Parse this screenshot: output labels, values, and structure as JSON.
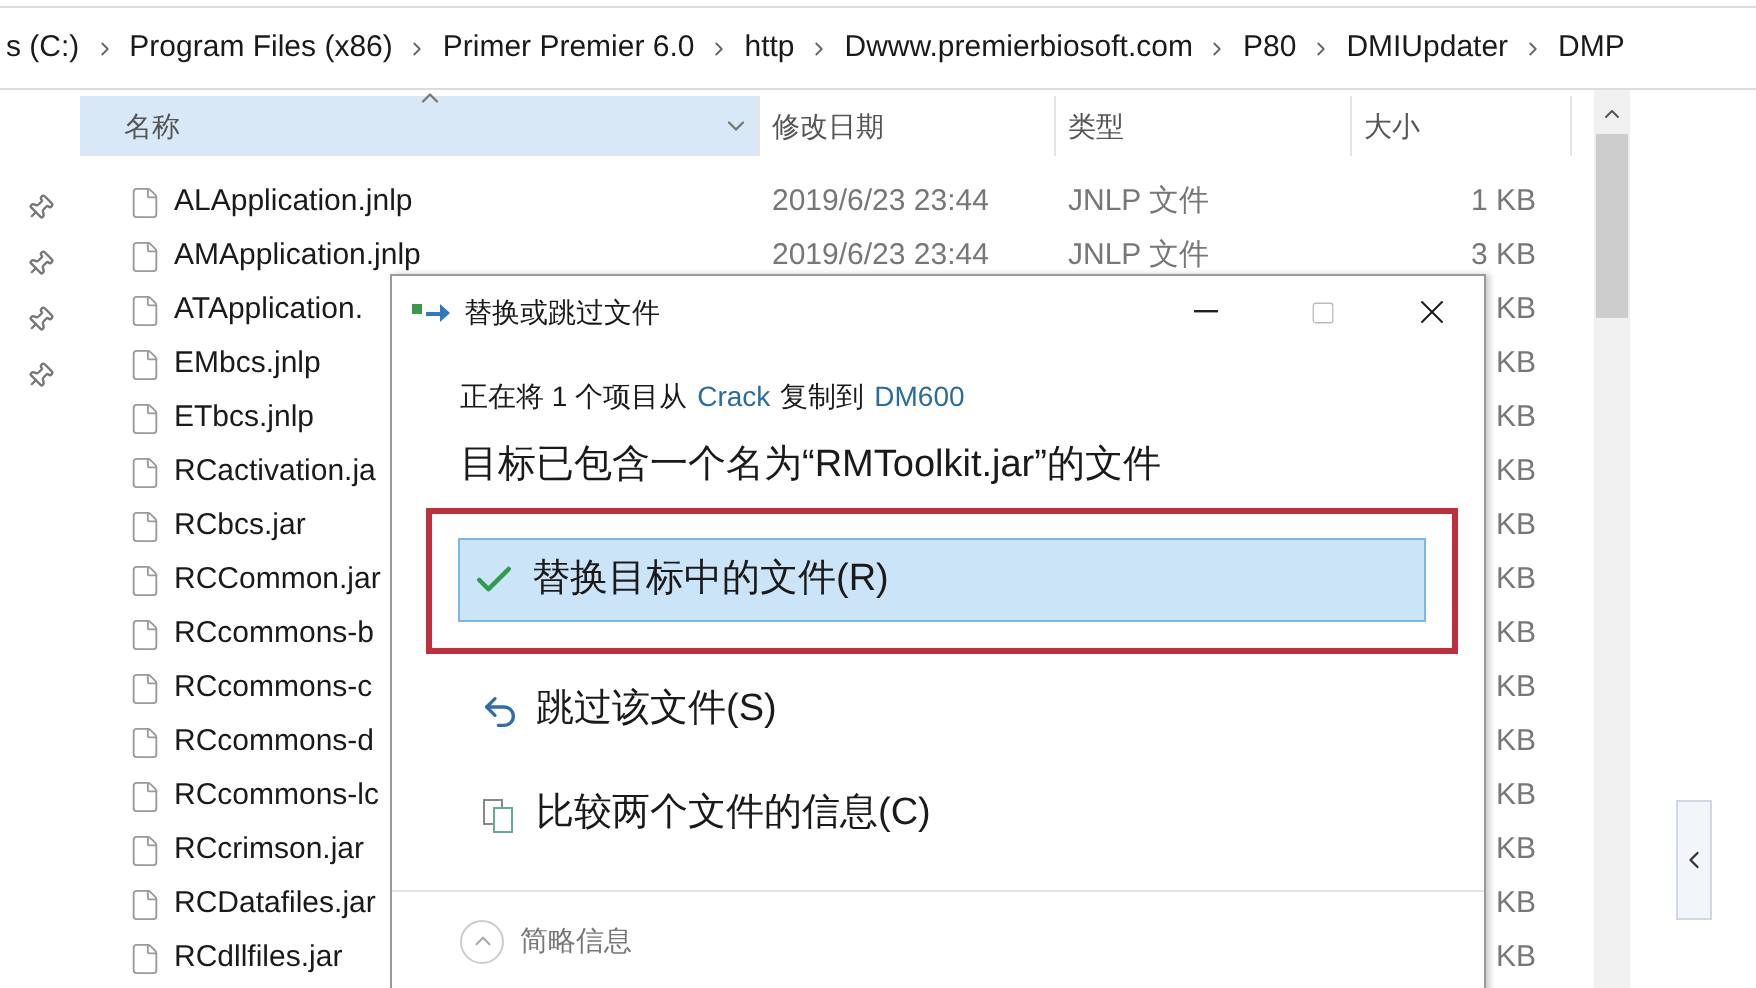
{
  "breadcrumb": [
    "s (C:)",
    "Program Files (x86)",
    "Primer Premier 6.0",
    "http",
    "Dwww.premierbiosoft.com",
    "P80",
    "DMIUpdater",
    "DMP"
  ],
  "columns": [
    {
      "label": "名称",
      "sorted": true
    },
    {
      "label": "修改日期",
      "sorted": false
    },
    {
      "label": "类型",
      "sorted": false
    },
    {
      "label": "大小",
      "sorted": false
    }
  ],
  "files": [
    {
      "name": "ALApplication.jnlp",
      "date": "2019/6/23 23:44",
      "type": "JNLP 文件",
      "size": "1 KB"
    },
    {
      "name": "AMApplication.jnlp",
      "date": "2019/6/23 23:44",
      "type": "JNLP 文件",
      "size": "3 KB"
    },
    {
      "name": "ATApplication.",
      "size": "KB"
    },
    {
      "name": "EMbcs.jnlp",
      "size": "KB"
    },
    {
      "name": "ETbcs.jnlp",
      "size": "KB"
    },
    {
      "name": "RCactivation.ja",
      "size": "KB"
    },
    {
      "name": "RCbcs.jar",
      "size": "KB"
    },
    {
      "name": "RCCommon.jar",
      "size": "KB"
    },
    {
      "name": "RCcommons-b",
      "size": "KB"
    },
    {
      "name": "RCcommons-c",
      "size": "KB"
    },
    {
      "name": "RCcommons-d",
      "size": "KB"
    },
    {
      "name": "RCcommons-lc",
      "size": "KB"
    },
    {
      "name": "RCcrimson.jar",
      "size": "KB"
    },
    {
      "name": "RCDatafiles.jar",
      "size": "KB"
    },
    {
      "name": "RCdllfiles.jar",
      "size": "KB"
    }
  ],
  "dialog": {
    "title": "替换或跳过文件",
    "copy_line": {
      "prefix": "正在将 1 个项目从",
      "source": "Crack",
      "middle": "复制到",
      "target": "DM600"
    },
    "heading": "目标已包含一个名为“RMToolkit.jar”的文件",
    "options": [
      {
        "kind": "replace",
        "label": "替换目标中的文件(R)",
        "selected": true
      },
      {
        "kind": "skip",
        "label": "跳过该文件(S)",
        "selected": false
      },
      {
        "kind": "compare",
        "label": "比较两个文件的信息(C)",
        "selected": false
      }
    ],
    "details": "简略信息"
  }
}
